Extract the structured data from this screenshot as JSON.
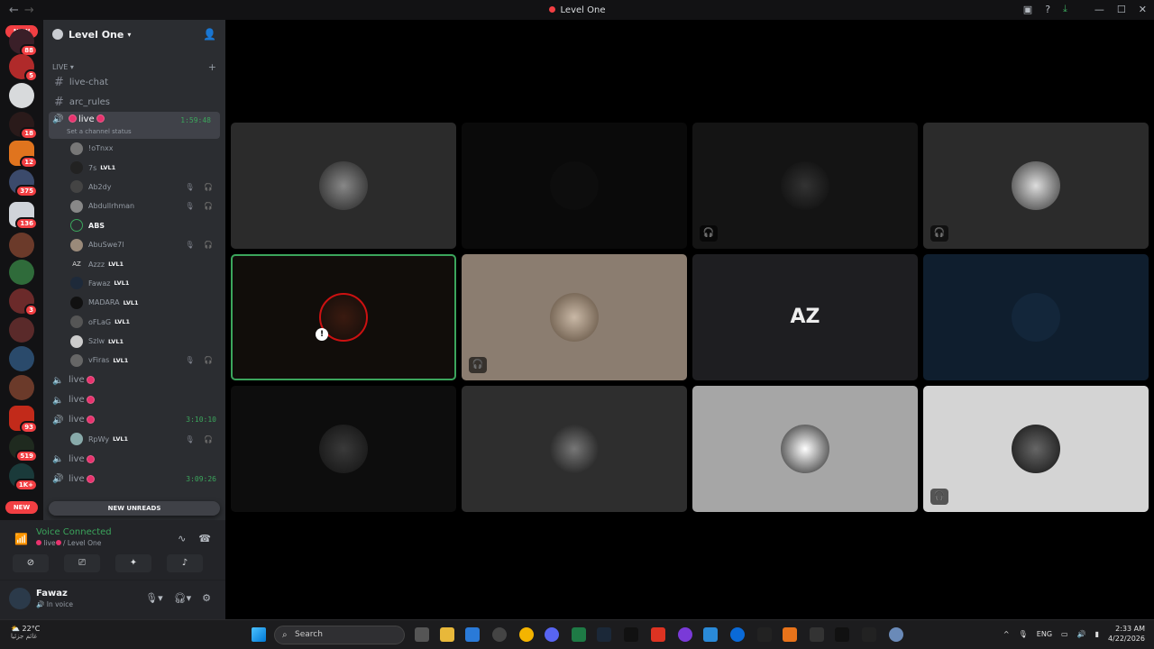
{
  "window": {
    "title": "Level One",
    "nav_back": "←",
    "nav_fwd": "→"
  },
  "servers": {
    "new_top": "NEW",
    "new_bottom": "NEW",
    "badges": [
      "88",
      "5",
      "18",
      "12",
      "375",
      "136",
      "3",
      "93",
      "519",
      "1K+"
    ]
  },
  "guild": {
    "name": "Level One"
  },
  "category": {
    "label": "LIVE",
    "add": "+"
  },
  "text_channels": [
    "live-chat",
    "arc_rules"
  ],
  "active_voice": {
    "name": "live",
    "time": "1:59:48",
    "status": "Set a channel status"
  },
  "members": [
    {
      "name": "!oTnxx",
      "lvl": "",
      "icons": ""
    },
    {
      "name": "7s",
      "lvl": "LVL1",
      "icons": ""
    },
    {
      "name": "Ab2dy",
      "lvl": "",
      "icons": "🎙 🎧"
    },
    {
      "name": "Abdullrhman",
      "lvl": "",
      "icons": "🎙 🎧"
    },
    {
      "name": "ABS",
      "lvl": "",
      "icons": ""
    },
    {
      "name": "AbuSwe7l",
      "lvl": "",
      "icons": "🎙 🎧"
    },
    {
      "name": "Azzz",
      "lvl": "LVL1",
      "icons": ""
    },
    {
      "name": "Fawaz",
      "lvl": "LVL1",
      "icons": ""
    },
    {
      "name": "MADARA",
      "lvl": "LVL1",
      "icons": ""
    },
    {
      "name": "oFLaG",
      "lvl": "LVL1",
      "icons": ""
    },
    {
      "name": "Szlw",
      "lvl": "LVL1",
      "icons": ""
    },
    {
      "name": "vFiras",
      "lvl": "LVL1",
      "icons": "🎙 🎧"
    }
  ],
  "other_voice": [
    {
      "name": "live",
      "time": ""
    },
    {
      "name": "live",
      "time": ""
    },
    {
      "name": "live",
      "time": "3:10:10"
    }
  ],
  "sub_member": {
    "name": "RpWy",
    "lvl": "LVL1"
  },
  "more_voice": [
    {
      "name": "live",
      "time": ""
    },
    {
      "name": "live",
      "time": "3:09:26"
    }
  ],
  "new_unreads": "NEW UNREADS",
  "voice_panel": {
    "connected": "Voice Connected",
    "channel": "live",
    "server": "/ Level One"
  },
  "user": {
    "name": "Fawaz",
    "status": "In voice"
  },
  "taskbar": {
    "temp": "22°C",
    "weather_sub": "غائم جزئيا",
    "search_placeholder": "Search",
    "lang": "ENG",
    "time": "2:33 AM",
    "date": "4/22/2026"
  },
  "colors": {
    "accent_green": "#3ba55c",
    "live_pink": "#e8336e",
    "danger": "#f23f43"
  }
}
